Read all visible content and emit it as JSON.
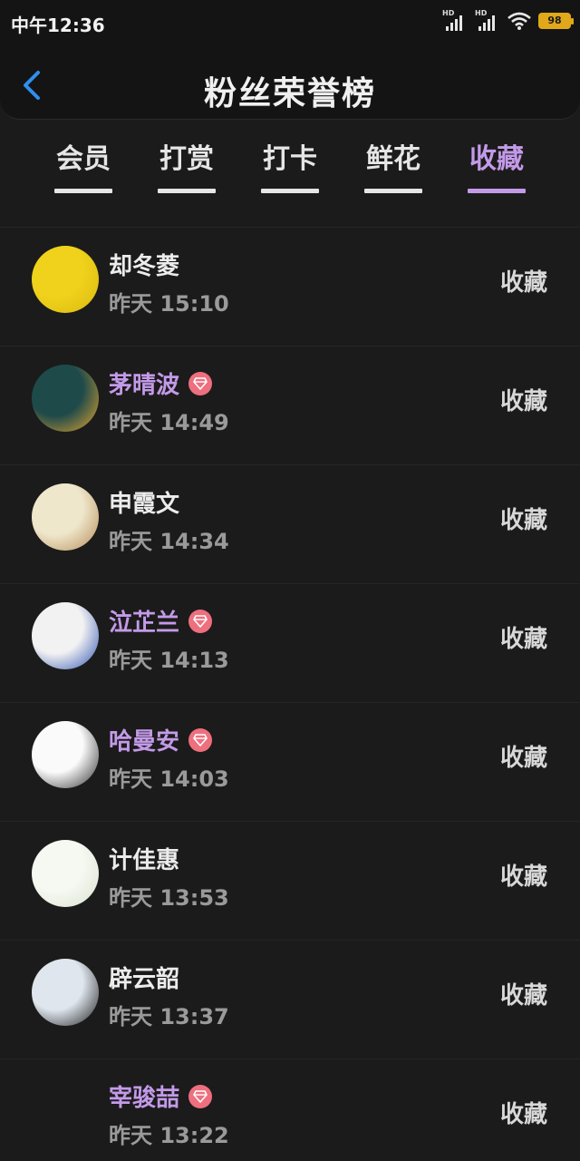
{
  "status_bar": {
    "time": "中午12:36",
    "battery": "98",
    "network_label": "HD"
  },
  "header": {
    "title": "粉丝荣誉榜"
  },
  "tabs": [
    {
      "label": "会员",
      "active": false
    },
    {
      "label": "打赏",
      "active": false
    },
    {
      "label": "打卡",
      "active": false
    },
    {
      "label": "鲜花",
      "active": false
    },
    {
      "label": "收藏",
      "active": true
    }
  ],
  "fans": [
    {
      "name": "却冬菱",
      "time": "昨天 15:10",
      "action": "收藏",
      "vip": false,
      "avatar_colors": [
        "#f0d21c",
        "#d9b90f"
      ]
    },
    {
      "name": "茅晴波",
      "time": "昨天 14:49",
      "action": "收藏",
      "vip": true,
      "avatar_colors": [
        "#1f4a4a",
        "#e9a82e"
      ]
    },
    {
      "name": "申霞文",
      "time": "昨天 14:34",
      "action": "收藏",
      "vip": false,
      "avatar_colors": [
        "#efe7cc",
        "#b58a55"
      ]
    },
    {
      "name": "泣芷兰",
      "time": "昨天 14:13",
      "action": "收藏",
      "vip": true,
      "avatar_colors": [
        "#f2f2f2",
        "#2a4fb0"
      ]
    },
    {
      "name": "哈曼安",
      "time": "昨天 14:03",
      "action": "收藏",
      "vip": true,
      "avatar_colors": [
        "#fafafa",
        "#2b2b2b"
      ]
    },
    {
      "name": "计佳惠",
      "time": "昨天 13:53",
      "action": "收藏",
      "vip": false,
      "avatar_colors": [
        "#f6f8f2",
        "#d9e3cf"
      ]
    },
    {
      "name": "辟云韶",
      "time": "昨天 13:37",
      "action": "收藏",
      "vip": false,
      "avatar_colors": [
        "#dfe6ee",
        "#1b1b1b"
      ]
    },
    {
      "name": "宰骏喆",
      "time": "昨天 13:22",
      "action": "收藏",
      "vip": true,
      "avatar_colors": [
        "#1b1b1b",
        "#1b1b1b"
      ]
    }
  ],
  "colors": {
    "accent": "#c39ae8",
    "vip_badge": "#ee6f7e",
    "back_arrow": "#2f8ff0",
    "battery": "#e0a81a"
  }
}
